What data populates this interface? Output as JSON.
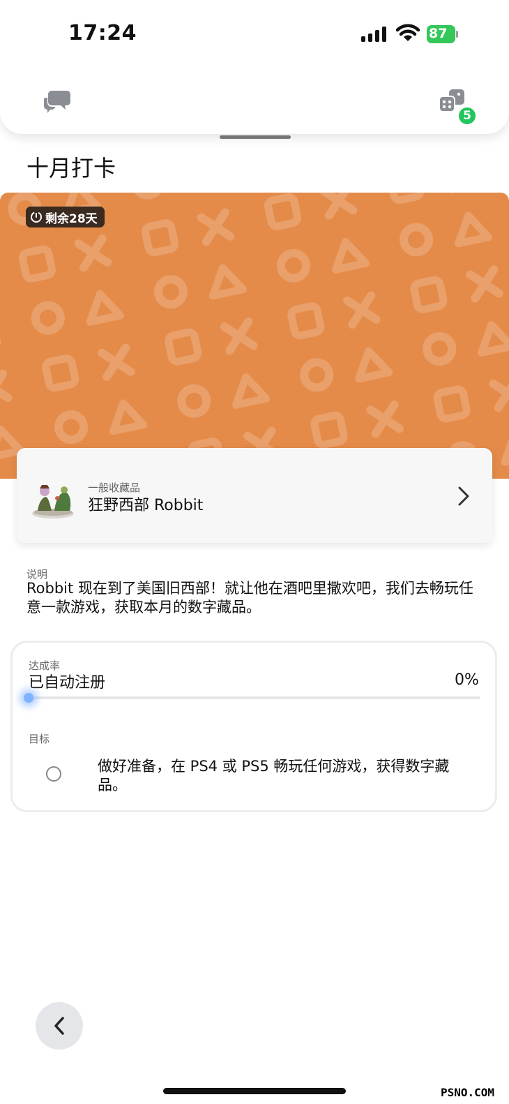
{
  "status_bar": {
    "time": "17:24",
    "battery": "87"
  },
  "header": {
    "badge_count": "5"
  },
  "page_title": "十月打卡",
  "banner": {
    "remaining_label": "剩余28天",
    "color": "#e48b4a"
  },
  "item": {
    "category": "一般收藏品",
    "name": "狂野西部 Robbit"
  },
  "description": {
    "label": "说明",
    "text": "Robbit 现在到了美国旧西部！就让他在酒吧里撒欢吧，我们去畅玩任意一款游戏，获取本月的数字藏品。"
  },
  "progress": {
    "label": "达成率",
    "status": "已自动注册",
    "value_text": "0%",
    "value_fraction": 0
  },
  "goal": {
    "label": "目标",
    "text": "做好准备，在 PS4 或 PS5 畅玩任何游戏，获得数字藏品。"
  },
  "watermark": "PSNO.COM",
  "colors": {
    "accent": "#3b82f6",
    "badge": "#22c55e"
  },
  "icons": [
    "chat-icon",
    "dice-icon",
    "timer-icon",
    "chevron-right-icon",
    "back-arrow-icon",
    "signal-icon",
    "wifi-icon",
    "battery-icon"
  ]
}
